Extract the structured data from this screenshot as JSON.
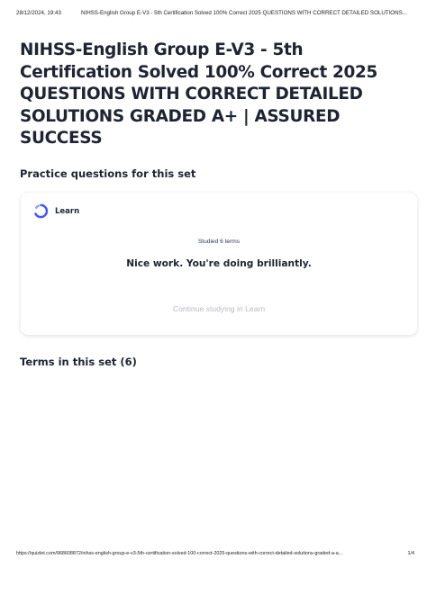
{
  "print_header": {
    "datetime": "28/12/2024, 19:43",
    "doc_title": "NIHSS-English Group E-V3 - 5th Certification Solved 100% Correct 2025 QUESTIONS WITH CORRECT DETAILED SOLUTIONS..."
  },
  "set_title": "NIHSS-English Group E-V3 - 5th Certification Solved 100% Correct 2025 QUESTIONS WITH CORRECT DETAILED SOLUTIONS GRADED A+ | ASSURED SUCCESS",
  "practice": {
    "heading": "Practice questions for this set",
    "mode_label": "Learn",
    "mode_icon": "learn-progress-icon",
    "studied": "Studied 6 terms",
    "encouragement": "Nice work. You're doing brilliantly.",
    "continue_label": "Continue studying in Learn"
  },
  "terms_heading": "Terms in this set (6)",
  "print_footer": {
    "url": "https://quizlet.com/968608872/nihss-english-group-e-v3-5th-certification-solved-100-correct-2025-questions-with-correct-detailed-solutions-graded-a-a...",
    "page": "1/4"
  },
  "colors": {
    "learn_blue": "#4255ff",
    "text_dark": "#1f2433",
    "muted": "#b7bbc8"
  }
}
